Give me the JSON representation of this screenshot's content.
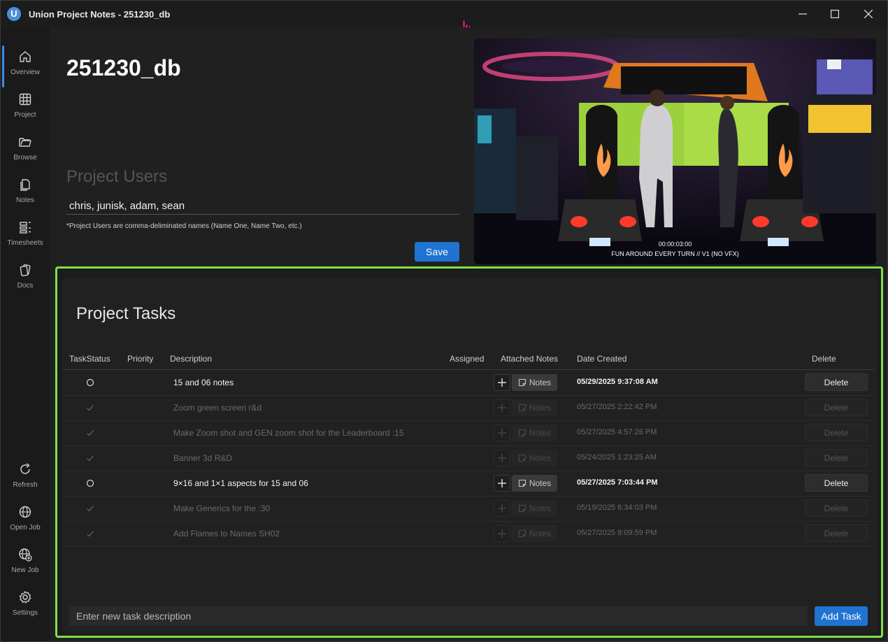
{
  "window": {
    "logo_letter": "U",
    "title": "Union Project Notes - 251230_db"
  },
  "sidebar": {
    "items": [
      {
        "label": "Overview",
        "icon": "home-icon"
      },
      {
        "label": "Project",
        "icon": "table-icon"
      },
      {
        "label": "Browse",
        "icon": "folder-icon"
      },
      {
        "label": "Notes",
        "icon": "notes-icon"
      },
      {
        "label": "Timesheets",
        "icon": "timesheet-icon"
      },
      {
        "label": "Docs",
        "icon": "docs-icon"
      },
      {
        "label": "Refresh",
        "icon": "refresh-icon"
      },
      {
        "label": "Open Job",
        "icon": "globe-icon"
      },
      {
        "label": "New Job",
        "icon": "globe-plus-icon"
      },
      {
        "label": "Settings",
        "icon": "gear-icon"
      }
    ],
    "active": "Overview"
  },
  "overview": {
    "job_title": "251230_db",
    "users_heading": "Project Users",
    "users_value": "chris, junisk, adam, sean",
    "users_note": "*Project Users are comma-deliminated names (Name One, Name Two, etc.)",
    "save_label": "Save"
  },
  "preview": {
    "timecode": "00:00:03:00",
    "label": "FUN AROUND EVERY TURN // V1 (NO VFX)"
  },
  "tasks": {
    "heading": "Project Tasks",
    "columns": {
      "status": "TaskStatus",
      "priority": "Priority",
      "description": "Description",
      "assigned": "Assigned",
      "notes": "Attached Notes",
      "date": "Date Created",
      "delete": "Delete"
    },
    "notes_label": "Notes",
    "delete_label": "Delete",
    "rows": [
      {
        "done": false,
        "description": "15 and 06 notes",
        "date": "05/29/2025 9:37:08 AM"
      },
      {
        "done": true,
        "description": "Zoom green screen r&d",
        "date": "05/27/2025 2:22:42 PM"
      },
      {
        "done": true,
        "description": "Make Zoom shot and GEN zoom shot for the Leaderboard :15",
        "date": "05/27/2025 4:57:26 PM"
      },
      {
        "done": true,
        "description": "Banner 3d R&D",
        "date": "05/24/2025 1:23:25 AM"
      },
      {
        "done": false,
        "description": "9×16 and 1×1 aspects for 15 and 06",
        "date": "05/27/2025 7:03:44 PM"
      },
      {
        "done": true,
        "description": "Make Generics for the :30",
        "date": "05/19/2025 6:34:03 PM"
      },
      {
        "done": true,
        "description": "Add Flames to Names SH02",
        "date": "05/27/2025 8:09:59 PM"
      }
    ],
    "new_task_placeholder": "Enter new task description",
    "add_task_label": "Add Task"
  },
  "colors": {
    "accent": "#1f73d1",
    "highlight_frame": "#7ee04a",
    "cursor": "#ff2fa6"
  }
}
